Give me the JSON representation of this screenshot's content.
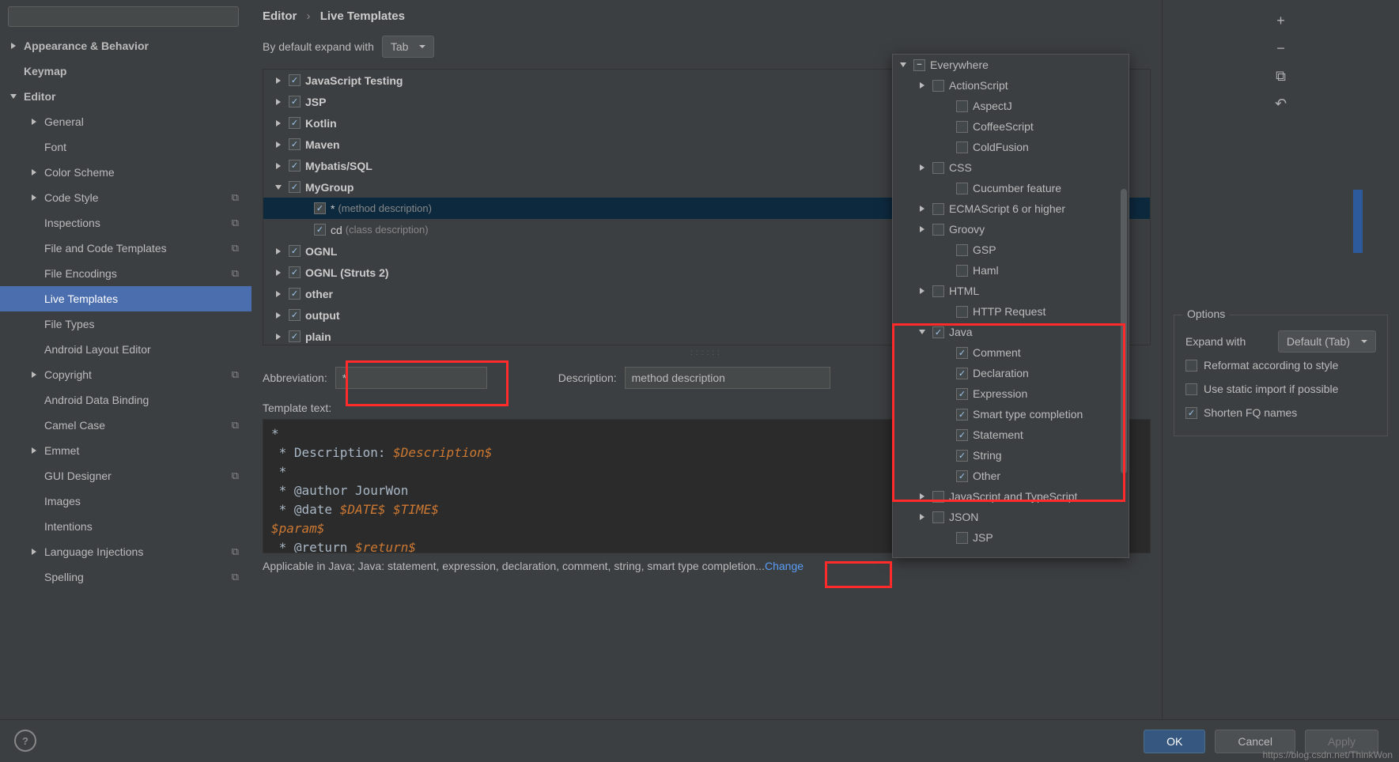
{
  "breadcrumb": {
    "root": "Editor",
    "current": "Live Templates"
  },
  "sidebar": {
    "search_placeholder": "",
    "items": [
      {
        "label": "Appearance & Behavior",
        "arrow": "right",
        "bold": true,
        "indent": 0
      },
      {
        "label": "Keymap",
        "arrow": "",
        "bold": true,
        "indent": 0
      },
      {
        "label": "Editor",
        "arrow": "down",
        "bold": true,
        "indent": 0
      },
      {
        "label": "General",
        "arrow": "right",
        "bold": false,
        "indent": 1
      },
      {
        "label": "Font",
        "arrow": "",
        "bold": false,
        "indent": 1
      },
      {
        "label": "Color Scheme",
        "arrow": "right",
        "bold": false,
        "indent": 1
      },
      {
        "label": "Code Style",
        "arrow": "right",
        "bold": false,
        "indent": 1,
        "icon": true
      },
      {
        "label": "Inspections",
        "arrow": "",
        "bold": false,
        "indent": 1,
        "icon": true
      },
      {
        "label": "File and Code Templates",
        "arrow": "",
        "bold": false,
        "indent": 1,
        "icon": true
      },
      {
        "label": "File Encodings",
        "arrow": "",
        "bold": false,
        "indent": 1,
        "icon": true
      },
      {
        "label": "Live Templates",
        "arrow": "",
        "bold": false,
        "indent": 1,
        "selected": true
      },
      {
        "label": "File Types",
        "arrow": "",
        "bold": false,
        "indent": 1
      },
      {
        "label": "Android Layout Editor",
        "arrow": "",
        "bold": false,
        "indent": 1
      },
      {
        "label": "Copyright",
        "arrow": "right",
        "bold": false,
        "indent": 1,
        "icon": true
      },
      {
        "label": "Android Data Binding",
        "arrow": "",
        "bold": false,
        "indent": 1
      },
      {
        "label": "Camel Case",
        "arrow": "",
        "bold": false,
        "indent": 1,
        "icon": true
      },
      {
        "label": "Emmet",
        "arrow": "right",
        "bold": false,
        "indent": 1
      },
      {
        "label": "GUI Designer",
        "arrow": "",
        "bold": false,
        "indent": 1,
        "icon": true
      },
      {
        "label": "Images",
        "arrow": "",
        "bold": false,
        "indent": 1
      },
      {
        "label": "Intentions",
        "arrow": "",
        "bold": false,
        "indent": 1
      },
      {
        "label": "Language Injections",
        "arrow": "right",
        "bold": false,
        "indent": 1,
        "icon": true
      },
      {
        "label": "Spelling",
        "arrow": "",
        "bold": false,
        "indent": 1,
        "icon": true
      }
    ]
  },
  "expand": {
    "label": "By default expand with",
    "value": "Tab"
  },
  "groups": [
    {
      "label": "JavaScript Testing",
      "arrow": "right",
      "checked": true
    },
    {
      "label": "JSP",
      "arrow": "right",
      "checked": true
    },
    {
      "label": "Kotlin",
      "arrow": "right",
      "checked": true
    },
    {
      "label": "Maven",
      "arrow": "right",
      "checked": true
    },
    {
      "label": "Mybatis/SQL",
      "arrow": "right",
      "checked": true
    },
    {
      "label": "MyGroup",
      "arrow": "down",
      "checked": true
    },
    {
      "label": "*",
      "desc": "(method description)",
      "arrow": "",
      "checked": true,
      "indent": true,
      "selected": true
    },
    {
      "label": "cd",
      "desc": "(class description)",
      "arrow": "",
      "checked": true,
      "indent": true
    },
    {
      "label": "OGNL",
      "arrow": "right",
      "checked": true
    },
    {
      "label": "OGNL (Struts 2)",
      "arrow": "right",
      "checked": true
    },
    {
      "label": "other",
      "arrow": "right",
      "checked": true
    },
    {
      "label": "output",
      "arrow": "right",
      "checked": true
    },
    {
      "label": "plain",
      "arrow": "right",
      "checked": true
    }
  ],
  "form": {
    "abbr_label": "Abbreviation:",
    "abbr_value": "*",
    "desc_label": "Description:",
    "desc_value": "method description",
    "template_label": "Template text:"
  },
  "code_lines": [
    "*",
    " * Description: $Description$",
    " *",
    " * @author JourWon",
    " * @date $DATE$ $TIME$",
    "$param$",
    " * @return $return$"
  ],
  "applicable": {
    "text": "Applicable in Java; Java: statement, expression, declaration, comment, string, smart type completion...",
    "link": "Change"
  },
  "toolbar": {
    "add": "+",
    "remove": "−",
    "copy": "⧉",
    "undo": "↶"
  },
  "options": {
    "title": "Options",
    "items": [
      {
        "label": "Expand with",
        "type": "dropdown",
        "value": "Default (Tab)"
      },
      {
        "label": "Reformat according to style",
        "checked": false
      },
      {
        "label": "Use static import if possible",
        "checked": false
      },
      {
        "label": "Shorten FQ names",
        "checked": true
      }
    ]
  },
  "context": [
    {
      "label": "Everywhere",
      "arrow": "down",
      "cb": "minus",
      "indent": 0
    },
    {
      "label": "ActionScript",
      "arrow": "right",
      "cb": "",
      "indent": 1
    },
    {
      "label": "AspectJ",
      "arrow": "",
      "cb": "",
      "indent": 2
    },
    {
      "label": "CoffeeScript",
      "arrow": "",
      "cb": "",
      "indent": 2
    },
    {
      "label": "ColdFusion",
      "arrow": "",
      "cb": "",
      "indent": 2
    },
    {
      "label": "CSS",
      "arrow": "right",
      "cb": "",
      "indent": 1
    },
    {
      "label": "Cucumber feature",
      "arrow": "",
      "cb": "",
      "indent": 2
    },
    {
      "label": "ECMAScript 6 or higher",
      "arrow": "right",
      "cb": "",
      "indent": 1
    },
    {
      "label": "Groovy",
      "arrow": "right",
      "cb": "",
      "indent": 1
    },
    {
      "label": "GSP",
      "arrow": "",
      "cb": "",
      "indent": 2
    },
    {
      "label": "Haml",
      "arrow": "",
      "cb": "",
      "indent": 2
    },
    {
      "label": "HTML",
      "arrow": "right",
      "cb": "",
      "indent": 1
    },
    {
      "label": "HTTP Request",
      "arrow": "",
      "cb": "",
      "indent": 2
    },
    {
      "label": "Java",
      "arrow": "down",
      "cb": "check",
      "indent": 1
    },
    {
      "label": "Comment",
      "arrow": "",
      "cb": "check",
      "indent": 2
    },
    {
      "label": "Declaration",
      "arrow": "",
      "cb": "check",
      "indent": 2
    },
    {
      "label": "Expression",
      "arrow": "",
      "cb": "check",
      "indent": 2
    },
    {
      "label": "Smart type completion",
      "arrow": "",
      "cb": "check",
      "indent": 2
    },
    {
      "label": "Statement",
      "arrow": "",
      "cb": "check",
      "indent": 2
    },
    {
      "label": "String",
      "arrow": "",
      "cb": "check",
      "indent": 2
    },
    {
      "label": "Other",
      "arrow": "",
      "cb": "check",
      "indent": 2
    },
    {
      "label": "JavaScript and TypeScript",
      "arrow": "right",
      "cb": "",
      "indent": 1
    },
    {
      "label": "JSON",
      "arrow": "right",
      "cb": "",
      "indent": 1
    },
    {
      "label": "JSP",
      "arrow": "",
      "cb": "",
      "indent": 2
    }
  ],
  "buttons": {
    "ok": "OK",
    "cancel": "Cancel",
    "apply": "Apply"
  },
  "watermark": "https://blog.csdn.net/ThinkWon"
}
